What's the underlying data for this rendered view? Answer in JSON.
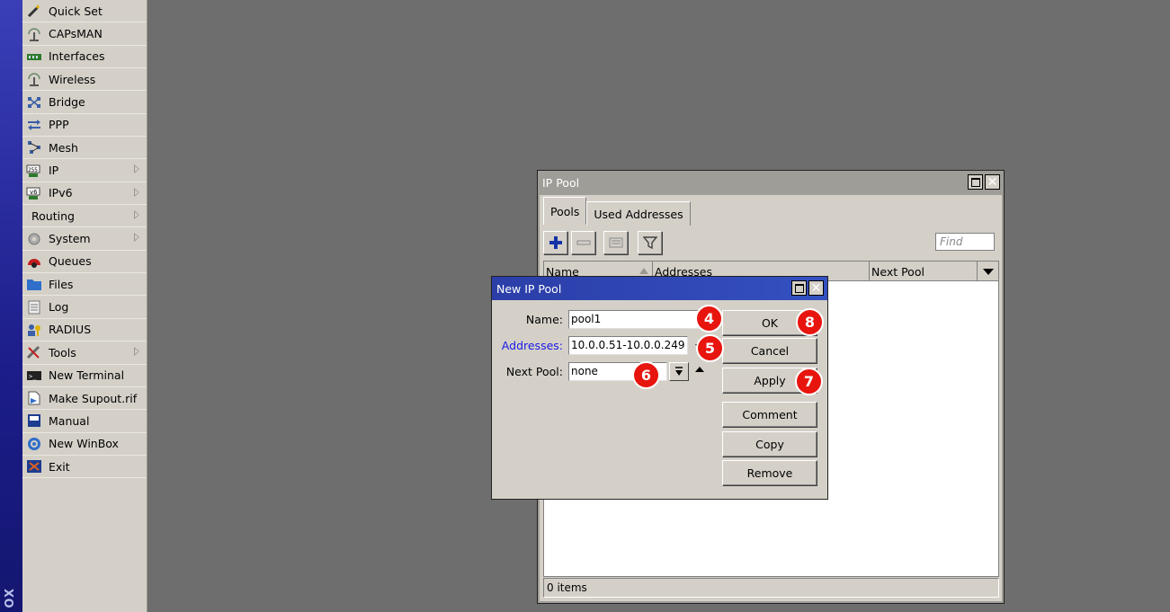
{
  "brand": {
    "text": "OX"
  },
  "sidebar": {
    "items": [
      {
        "label": "Quick Set",
        "icon": "wand-icon",
        "submenu": false
      },
      {
        "label": "CAPsMAN",
        "icon": "antenna-icon",
        "submenu": false
      },
      {
        "label": "Interfaces",
        "icon": "network-card-icon",
        "submenu": false
      },
      {
        "label": "Wireless",
        "icon": "wireless-icon",
        "submenu": false
      },
      {
        "label": "Bridge",
        "icon": "bridge-icon",
        "submenu": false
      },
      {
        "label": "PPP",
        "icon": "ppp-icon",
        "submenu": false
      },
      {
        "label": "Mesh",
        "icon": "mesh-icon",
        "submenu": false
      },
      {
        "label": "IP",
        "icon": "ip-icon",
        "submenu": true
      },
      {
        "label": "IPv6",
        "icon": "ipv6-icon",
        "submenu": true
      },
      {
        "label": "Routing",
        "icon": "",
        "submenu": true
      },
      {
        "label": "System",
        "icon": "gear-icon",
        "submenu": true
      },
      {
        "label": "Queues",
        "icon": "queues-icon",
        "submenu": false
      },
      {
        "label": "Files",
        "icon": "folder-icon",
        "submenu": false
      },
      {
        "label": "Log",
        "icon": "log-icon",
        "submenu": false
      },
      {
        "label": "RADIUS",
        "icon": "radius-icon",
        "submenu": false
      },
      {
        "label": "Tools",
        "icon": "tools-icon",
        "submenu": true
      },
      {
        "label": "New Terminal",
        "icon": "terminal-icon",
        "submenu": false
      },
      {
        "label": "Make Supout.rif",
        "icon": "supout-icon",
        "submenu": false
      },
      {
        "label": "Manual",
        "icon": "manual-icon",
        "submenu": false
      },
      {
        "label": "New WinBox",
        "icon": "winbox-icon",
        "submenu": false
      },
      {
        "label": "Exit",
        "icon": "exit-icon",
        "submenu": false
      }
    ]
  },
  "ip_pool_window": {
    "title": "IP Pool",
    "tabs": [
      {
        "label": "Pools",
        "active": true
      },
      {
        "label": "Used Addresses",
        "active": false
      }
    ],
    "find_placeholder": "Find",
    "columns": [
      "Name",
      "Addresses",
      "Next Pool"
    ],
    "status": "0 items"
  },
  "new_pool_dialog": {
    "title": "New IP Pool",
    "name_label": "Name:",
    "name_value": "pool1",
    "addresses_label": "Addresses:",
    "addresses_value": "10.0.0.51-10.0.0.249",
    "next_pool_label": "Next Pool:",
    "next_pool_value": "none",
    "buttons": {
      "ok": "OK",
      "cancel": "Cancel",
      "apply": "Apply",
      "comment": "Comment",
      "copy": "Copy",
      "remove": "Remove"
    }
  },
  "callouts": {
    "c4": "4",
    "c5": "5",
    "c6": "6",
    "c7": "7",
    "c8": "8"
  },
  "colors": {
    "accent": "#e8150f",
    "title_active": "#2b3ea8",
    "addresses_label": "#1a1ae6"
  }
}
